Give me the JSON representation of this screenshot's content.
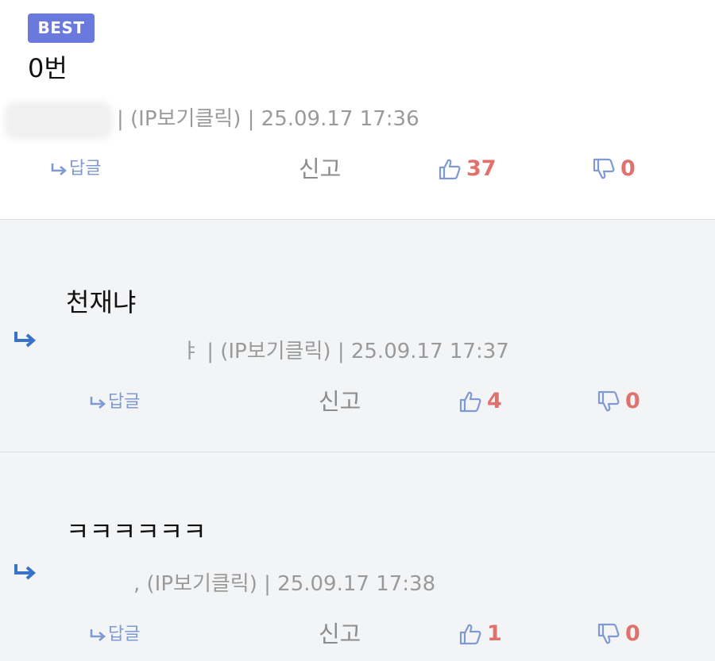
{
  "comments": [
    {
      "badge": "BEST",
      "text": "0번",
      "ip_label": "(IP보기클릭)",
      "date": "25.09.17 17:36",
      "reply_label": "답글",
      "report_label": "신고",
      "likes": "37",
      "dislikes": "0"
    },
    {
      "text": "천재냐",
      "author_fragment": "ㅑ",
      "ip_label": "(IP보기클릭)",
      "date": "25.09.17 17:37",
      "reply_label": "답글",
      "report_label": "신고",
      "likes": "4",
      "dislikes": "0"
    },
    {
      "text": "ㅋㅋㅋㅋㅋㅋ",
      "author_fragment": ",",
      "ip_label": "(IP보기클릭)",
      "date": "25.09.17 17:38",
      "reply_label": "답글",
      "report_label": "신고",
      "likes": "1",
      "dislikes": "0"
    }
  ],
  "colors": {
    "badge_bg": "#6a79de",
    "accent_blue": "#7f9ad2",
    "reply_arrow": "#3a72c8",
    "vote_count": "#e0716d",
    "meta_text": "#9a9a9a"
  },
  "icons": [
    "reply-arrow-icon",
    "thumbs-up-icon",
    "thumbs-down-icon"
  ]
}
